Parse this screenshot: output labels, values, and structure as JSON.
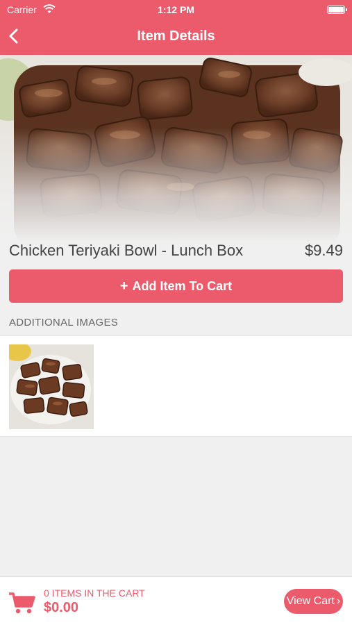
{
  "status_bar": {
    "carrier": "Carrier",
    "time": "1:12 PM"
  },
  "header": {
    "title": "Item Details"
  },
  "item": {
    "name": "Chicken Teriyaki Bowl - Lunch Box",
    "price": "$9.49"
  },
  "actions": {
    "add_to_cart_icon": "+",
    "add_to_cart_label": "Add Item To Cart"
  },
  "additional_images": {
    "title": "ADDITIONAL IMAGES"
  },
  "cart": {
    "count_label": "0 ITEMS IN THE CART",
    "total": "$0.00",
    "view_cart_label": "View Cart",
    "view_cart_icon": "›"
  },
  "colors": {
    "accent": "#ec5b6b",
    "background": "#f0f0f0"
  }
}
